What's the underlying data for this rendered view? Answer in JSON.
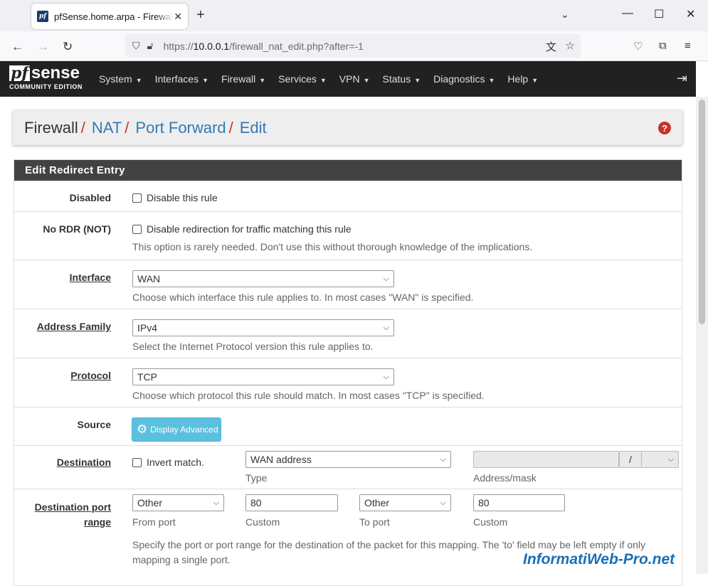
{
  "browser": {
    "tab_title": "pfSense.home.arpa - Firewall: NAT: Port Forward: Edit",
    "url_prefix": "https://",
    "url_host": "10.0.0.1",
    "url_path": "/firewall_nat_edit.php?after=-1"
  },
  "nav": {
    "brand_pf": "pf",
    "brand_sense": "sense",
    "brand_edition": "COMMUNITY EDITION",
    "items": [
      "System",
      "Interfaces",
      "Firewall",
      "Services",
      "VPN",
      "Status",
      "Diagnostics",
      "Help"
    ]
  },
  "breadcrumb": {
    "first": "Firewall",
    "second": "NAT",
    "third": "Port Forward",
    "fourth": "Edit",
    "sep": "/"
  },
  "panel": {
    "title": "Edit Redirect Entry",
    "disabled": {
      "label": "Disabled",
      "checkbox_label": "Disable this rule"
    },
    "nordr": {
      "label": "No RDR (NOT)",
      "checkbox_label": "Disable redirection for traffic matching this rule",
      "help": "This option is rarely needed. Don't use this without thorough knowledge of the implications."
    },
    "interface": {
      "label": "Interface",
      "value": "WAN",
      "help": "Choose which interface this rule applies to. In most cases \"WAN\" is specified."
    },
    "address_family": {
      "label": "Address Family",
      "value": "IPv4",
      "help": "Select the Internet Protocol version this rule applies to."
    },
    "protocol": {
      "label": "Protocol",
      "value": "TCP",
      "help": "Choose which protocol this rule should match. In most cases \"TCP\" is specified."
    },
    "source": {
      "label": "Source",
      "button": "Display Advanced"
    },
    "destination": {
      "label": "Destination",
      "invert_label": "Invert match.",
      "type_value": "WAN address",
      "type_label": "Type",
      "address_value": "",
      "mask_sep": "/",
      "address_label": "Address/mask"
    },
    "dest_port": {
      "label_line1": "Destination port",
      "label_line2": "range",
      "from_value": "Other",
      "from_label": "From port",
      "from_custom": "80",
      "from_custom_label": "Custom",
      "to_value": "Other",
      "to_label": "To port",
      "to_custom": "80",
      "to_custom_label": "Custom",
      "help_line1": "Specify the port or port range for the destination of the packet for this mapping. The 'to' field may be left empty if only",
      "help_line2": "mapping a single port."
    }
  },
  "watermark": "InformatiWeb-Pro.net"
}
